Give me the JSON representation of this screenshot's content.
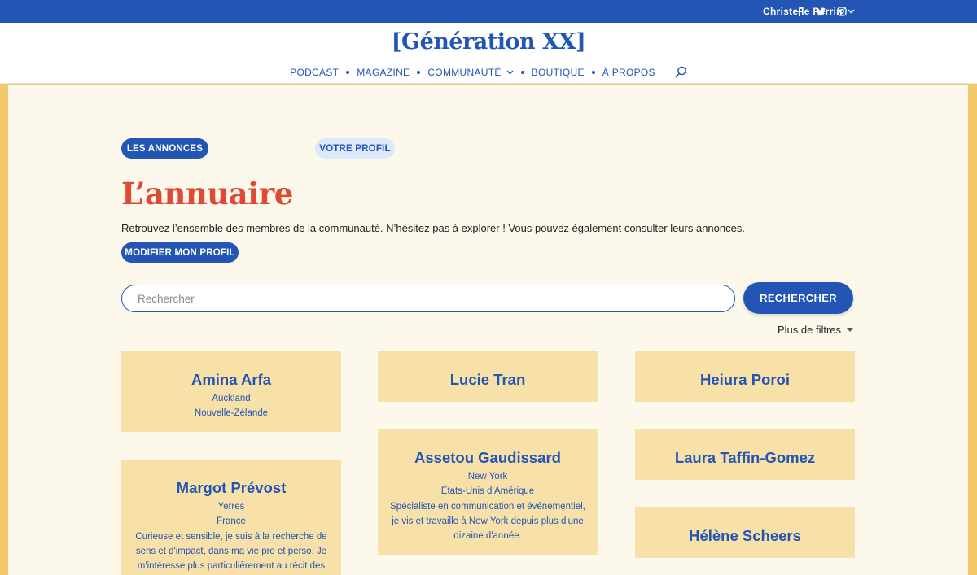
{
  "topbar": {
    "icons": [
      "facebook-icon",
      "twitter-icon",
      "instagram-icon"
    ],
    "user_name": "Christelle Perrin"
  },
  "header": {
    "logo": "[Génération XX]",
    "nav": [
      "PODCAST",
      "MAGAZINE",
      "COMMUNAUTÉ",
      "BOUTIQUE",
      "À PROPOS"
    ]
  },
  "tabs": {
    "annonces": "LES ANNONCES",
    "profil": "VOTRE PROFIL"
  },
  "page": {
    "title": "L’annuaire",
    "intro_before": "Retrouvez l’ensemble des membres de la communauté. N’hésitez pas à explorer ! Vous pouvez également consulter ",
    "intro_link": "leurs annonces",
    "intro_after": ".",
    "edit_button": "MODIFIER MON PROFIL"
  },
  "search": {
    "placeholder": "Rechercher",
    "button": "RECHERCHER",
    "filters": "Plus de filtres"
  },
  "members": [
    {
      "name": "Amina Arfa",
      "lines": [
        "Auckland",
        "Nouvelle-Zélande"
      ]
    },
    {
      "name": "Lucie Tran",
      "lines": []
    },
    {
      "name": "Heiura Poroi",
      "lines": []
    },
    {
      "name": "Margot Prévost",
      "lines": [
        "Yerres",
        "France",
        "Curieuse et sensible, je suis à la recherche de",
        "sens et d'impact, dans ma vie pro et perso. Je",
        "m'intéresse plus particulièrement au récit des"
      ]
    },
    {
      "name": "Assetou Gaudissard",
      "lines": [
        "New York",
        "États-Unis d’Amérique",
        "Spécialiste en communication et événementiel,",
        "je vis et travaille à New York depuis plus d'une",
        "dizaine d'année."
      ]
    },
    {
      "name": "Laura Taffin-Gomez",
      "lines": []
    },
    {
      "name": "Hélène Scheers",
      "lines": []
    }
  ]
}
